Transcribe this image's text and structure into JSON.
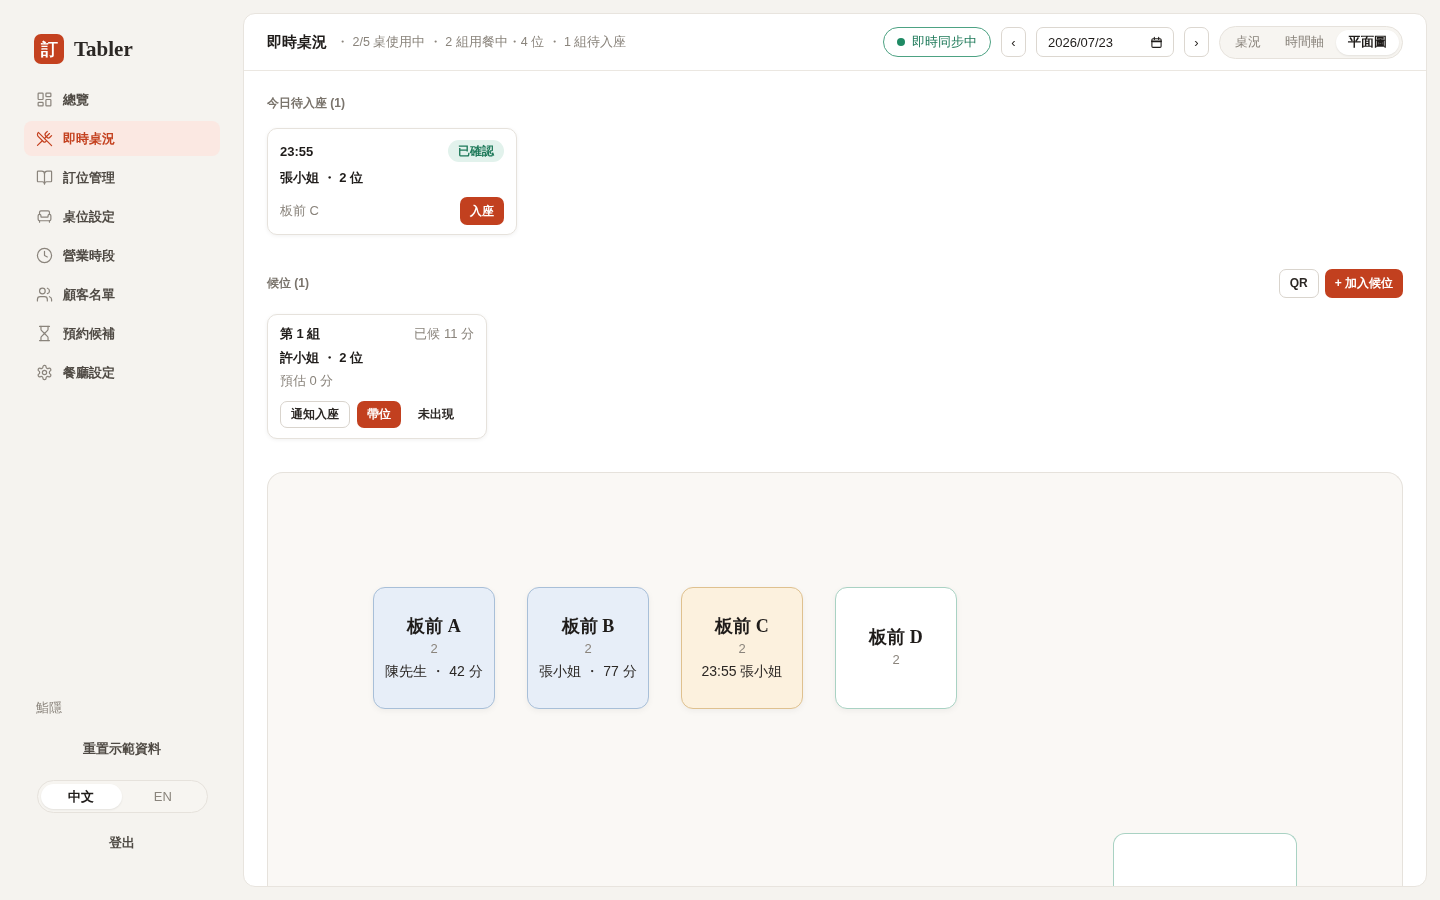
{
  "sidebar": {
    "brand": {
      "mark": "訂",
      "name": "Tabler"
    },
    "items": [
      {
        "label": "總覽",
        "selected": false
      },
      {
        "label": "即時桌況",
        "selected": true
      },
      {
        "label": "訂位管理",
        "selected": false
      },
      {
        "label": "桌位設定",
        "selected": false
      },
      {
        "label": "營業時段",
        "selected": false
      },
      {
        "label": "顧客名單",
        "selected": false
      },
      {
        "label": "預約候補",
        "selected": false
      },
      {
        "label": "餐廳設定",
        "selected": false
      }
    ],
    "restaurant": "鮨隱",
    "reset": "重置示範資料",
    "languages": [
      {
        "label": "中文",
        "selected": true
      },
      {
        "label": "EN",
        "selected": false
      }
    ],
    "logout": "登出"
  },
  "header": {
    "title": "即時桌況",
    "summary": "・ 2/5 桌使用中 ・ 2 組用餐中・4 位 ・ 1 組待入座",
    "sync": {
      "label": "即時同步中",
      "on": true
    },
    "prev": "‹",
    "date": "2026/07/23",
    "next": "›",
    "views": [
      {
        "label": "桌況",
        "selected": false
      },
      {
        "label": "時間軸",
        "selected": false
      },
      {
        "label": "平面圖",
        "selected": true
      }
    ]
  },
  "arrivals": {
    "title": "今日待入座 (1)",
    "cards": [
      {
        "time": "23:55",
        "status": "已確認",
        "guest": "張小姐 ・ 2 位",
        "table": "板前 C",
        "action": "入座"
      }
    ]
  },
  "waitlist": {
    "title": "候位 (1)",
    "buttons": [
      {
        "label": "QR",
        "kind": "outline"
      },
      {
        "label": "+ 加入候位",
        "kind": "primary"
      }
    ],
    "cards": [
      {
        "group": "第 1 組",
        "waited": "已候 11 分",
        "guest": "許小姐 ・ 2 位",
        "estimate": "預估 0 分",
        "actions": [
          {
            "label": "通知入座",
            "kind": "outline"
          },
          {
            "label": "帶位",
            "kind": "primary"
          },
          {
            "label": "未出現",
            "kind": "text"
          }
        ]
      }
    ]
  },
  "floor_plan": {
    "tables": [
      {
        "name": "板前 A",
        "seats": "2",
        "info": "陳先生 ・ 42 分",
        "kind": "occupied"
      },
      {
        "name": "板前 B",
        "seats": "2",
        "info": "張小姐 ・ 77 分",
        "kind": "occupied"
      },
      {
        "name": "板前 C",
        "seats": "2",
        "info": "23:55 張小姐",
        "kind": "reserved"
      },
      {
        "name": "板前 D",
        "seats": "2",
        "kind": "free"
      },
      {
        "kind": "free"
      }
    ]
  }
}
